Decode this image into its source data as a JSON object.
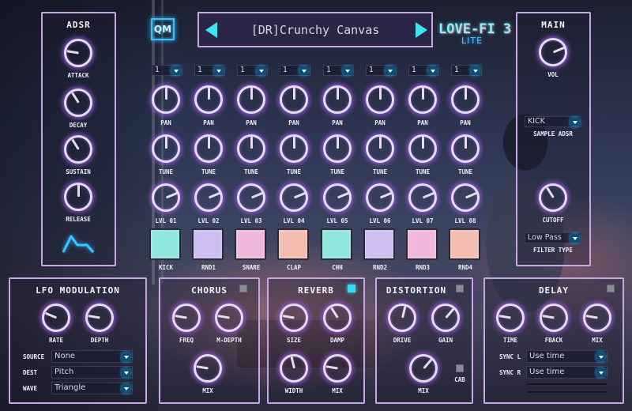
{
  "plugin": {
    "logo": "LOVE-FI 3",
    "logo_sub": "LITE",
    "brand_badge": "QM",
    "preset_name": "[DR]Crunchy Canvas",
    "preset_prev_icon": "triangle-left",
    "preset_next_icon": "triangle-right"
  },
  "colors": {
    "panel_border": "#c9a6e8",
    "accent_cyan": "#3ee4f4",
    "knob_glow": "#a05ae6"
  },
  "adsr": {
    "title": "ADSR",
    "knobs": [
      {
        "label": "ATTACK",
        "value": 0.2
      },
      {
        "label": "DECAY",
        "value": 0.38
      },
      {
        "label": "SUSTAIN",
        "value": 0.38
      },
      {
        "label": "RELEASE",
        "value": 0.5
      }
    ],
    "envelope_icon": "adsr-envelope"
  },
  "channels": {
    "outputs": [
      "1",
      "1",
      "1",
      "1",
      "1",
      "1",
      "1",
      "1"
    ],
    "pan": {
      "label": "PAN",
      "values": [
        0.5,
        0.5,
        0.5,
        0.5,
        0.5,
        0.5,
        0.5,
        0.5
      ]
    },
    "tune": {
      "label": "TUNE",
      "values": [
        0.5,
        0.5,
        0.5,
        0.5,
        0.5,
        0.5,
        0.5,
        0.5
      ]
    },
    "levels": [
      {
        "label": "LVL 01",
        "value": 0.75
      },
      {
        "label": "LVL 02",
        "value": 0.75
      },
      {
        "label": "LVL 03",
        "value": 0.75
      },
      {
        "label": "LVL 04",
        "value": 0.75
      },
      {
        "label": "LVL 05",
        "value": 0.75
      },
      {
        "label": "LVL 06",
        "value": 0.75
      },
      {
        "label": "LVL 07",
        "value": 0.75
      },
      {
        "label": "LVL 08",
        "value": 0.75
      }
    ],
    "pads": [
      {
        "label": "KICK",
        "color": "#8fe6dc"
      },
      {
        "label": "RND1",
        "color": "#cdbdf0"
      },
      {
        "label": "SNARE",
        "color": "#f0b8d8"
      },
      {
        "label": "CLAP",
        "color": "#f2bcb0"
      },
      {
        "label": "CHH",
        "color": "#8fe6dc"
      },
      {
        "label": "RND2",
        "color": "#cdbdf0"
      },
      {
        "label": "RND3",
        "color": "#f0b8d8"
      },
      {
        "label": "RND4",
        "color": "#f2bcb0"
      }
    ]
  },
  "main": {
    "title": "MAIN",
    "vol": {
      "label": "VOL",
      "value": 0.75
    },
    "sample_adsr": {
      "label": "SAMPLE ADSR",
      "selected": "KICK"
    },
    "cutoff": {
      "label": "CUTOFF",
      "value": 0.38
    },
    "filter_type": {
      "label": "FILTER TYPE",
      "selected": "Low Pass"
    }
  },
  "lfo": {
    "title": "LFO MODULATION",
    "knobs": [
      {
        "label": "RATE",
        "value": 0.25
      },
      {
        "label": "DEPTH",
        "value": 0.2
      }
    ],
    "source": {
      "label": "SOURCE",
      "selected": "None"
    },
    "dest": {
      "label": "DEST",
      "selected": "Pitch"
    },
    "wave": {
      "label": "WAVE",
      "selected": "Triangle"
    }
  },
  "chorus": {
    "title": "CHORUS",
    "enabled": false,
    "knobs": [
      {
        "label": "FREQ",
        "value": 0.2
      },
      {
        "label": "M-DEPTH",
        "value": 0.2
      },
      {
        "label": "MIX",
        "value": 0.2
      }
    ]
  },
  "reverb": {
    "title": "REVERB",
    "enabled": true,
    "knobs": [
      {
        "label": "SIZE",
        "value": 0.2
      },
      {
        "label": "DAMP",
        "value": 0.38
      },
      {
        "label": "WIDTH",
        "value": 0.45
      },
      {
        "label": "MIX",
        "value": 0.2
      }
    ]
  },
  "distortion": {
    "title": "DISTORTION",
    "enabled": false,
    "knobs": [
      {
        "label": "DRIVE",
        "value": 0.55
      },
      {
        "label": "GAIN",
        "value": 0.65
      },
      {
        "label": "MIX",
        "value": 0.65
      }
    ],
    "cab": {
      "label": "CAB",
      "enabled": false
    }
  },
  "delay": {
    "title": "DELAY",
    "enabled": false,
    "knobs": [
      {
        "label": "TIME",
        "value": 0.2
      },
      {
        "label": "FBACK",
        "value": 0.2
      },
      {
        "label": "MIX",
        "value": 0.2
      }
    ],
    "sync_l": {
      "label": "SYNC L",
      "selected": "Use time"
    },
    "sync_r": {
      "label": "SYNC R",
      "selected": "Use time"
    }
  }
}
